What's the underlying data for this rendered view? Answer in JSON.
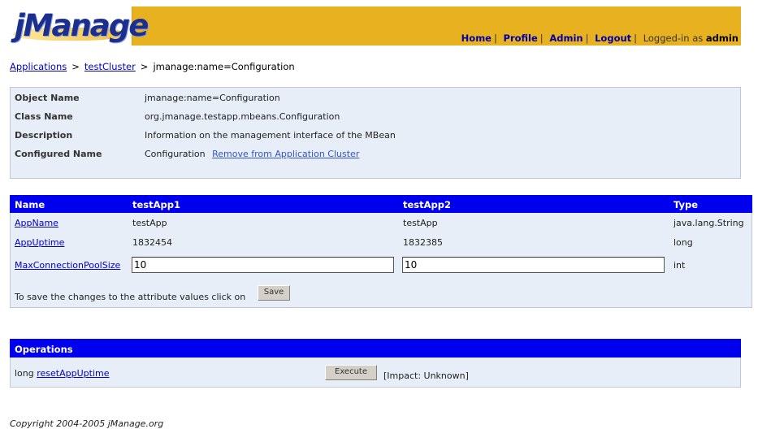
{
  "header": {
    "logo": "jManage",
    "nav": [
      {
        "label": "Home"
      },
      {
        "label": "Profile"
      },
      {
        "label": "Admin"
      },
      {
        "label": "Logout"
      }
    ],
    "logged_in_prefix": "Logged-in as",
    "user": "admin"
  },
  "breadcrumb": {
    "items": [
      "Applications",
      "testCluster"
    ],
    "current": "jmanage:name=Configuration",
    "separator": ">"
  },
  "info": {
    "object_name_label": "Object Name",
    "object_name": "jmanage:name=Configuration",
    "class_name_label": "Class Name",
    "class_name": "org.jmanage.testapp.mbeans.Configuration",
    "description_label": "Description",
    "description": "Information on the management interface of the MBean",
    "configured_name_label": "Configured Name",
    "configured_name": "Configuration",
    "remove_link": "Remove from Application Cluster"
  },
  "attributes": {
    "columns": [
      "Name",
      "testApp1",
      "testApp2",
      "Type"
    ],
    "rows": [
      {
        "name": "AppName",
        "app1": "testApp",
        "app2": "testApp",
        "type": "java.lang.String"
      },
      {
        "name": "AppUptime",
        "app1": "1832454",
        "app2": "1832385",
        "type": "long"
      },
      {
        "name": "MaxConnectionPoolSize",
        "app1": "10",
        "app2": "10",
        "type": "int"
      }
    ],
    "save_text": "To save the changes to the attribute values click on",
    "save_button": "Save"
  },
  "operations": {
    "title": "Operations",
    "items": [
      {
        "return_type": "long",
        "name": "resetAppUptime",
        "button": "Execute",
        "impact": "[Impact: Unknown]"
      }
    ]
  },
  "footer": {
    "copyright": "Copyright 2004-2005 jManage.org"
  },
  "colors": {
    "header_bg": "#e8b120",
    "table_header": "#0000ee",
    "panel_bg": "#e8eef7",
    "link": "#0000cc"
  }
}
